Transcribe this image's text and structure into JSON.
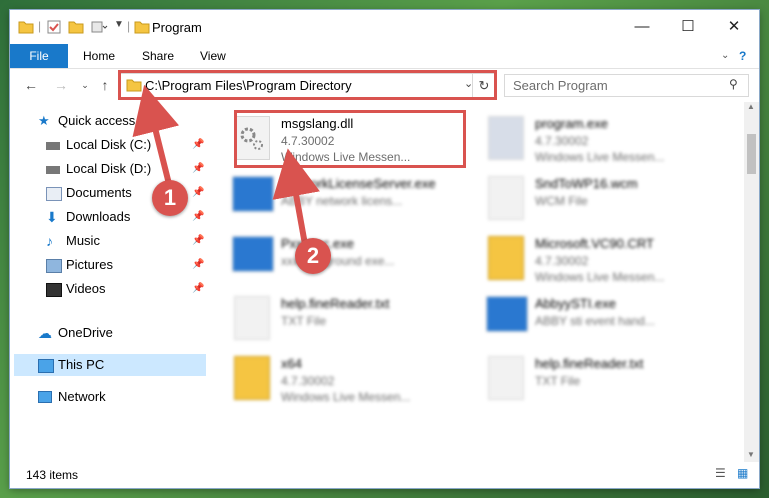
{
  "window": {
    "title": "Program"
  },
  "ribbon": {
    "file": "File",
    "home": "Home",
    "share": "Share",
    "view": "View"
  },
  "address": {
    "path": "C:\\Program Files\\Program Directory"
  },
  "search": {
    "placeholder": "Search Program"
  },
  "sidebar": {
    "quick_access": "Quick access",
    "items": [
      "Local Disk (C:)",
      "Local Disk (D:)",
      "Documents",
      "Downloads",
      "Music",
      "Pictures",
      "Videos"
    ],
    "onedrive": "OneDrive",
    "this_pc": "This PC",
    "network": "Network"
  },
  "files": [
    {
      "name": "msgslang.dll",
      "line1": "4.7.30002",
      "line2": "Windows Live Messen..."
    },
    {
      "name": "program.exe",
      "line1": "4.7.30002",
      "line2": "Windows Live Messen..."
    },
    {
      "name": "NetworkLicenseServer.exe",
      "line1": "ABBY network licens...",
      "line2": ""
    },
    {
      "name": "SndToWP16.wcm",
      "line1": "WCM File",
      "line2": ""
    },
    {
      "name": "Pxxxxec.exe",
      "line1": "xxxbackground exe...",
      "line2": ""
    },
    {
      "name": "Microsoft.VC90.CRT",
      "line1": "4.7.30002",
      "line2": "Windows Live Messen..."
    },
    {
      "name": "help.fineReader.txt",
      "line1": "TXT File",
      "line2": ""
    },
    {
      "name": "AbbyySTI.exe",
      "line1": "ABBY sti event hand...",
      "line2": ""
    },
    {
      "name": "x64",
      "line1": "4.7.30002",
      "line2": "Windows Live Messen..."
    },
    {
      "name": "help.fineReader.txt",
      "line1": "TXT File",
      "line2": ""
    }
  ],
  "status": {
    "count": "143 items"
  },
  "annotations": {
    "one": "1",
    "two": "2"
  },
  "colors": {
    "accent": "#1979ca",
    "highlight": "#d9534f"
  }
}
